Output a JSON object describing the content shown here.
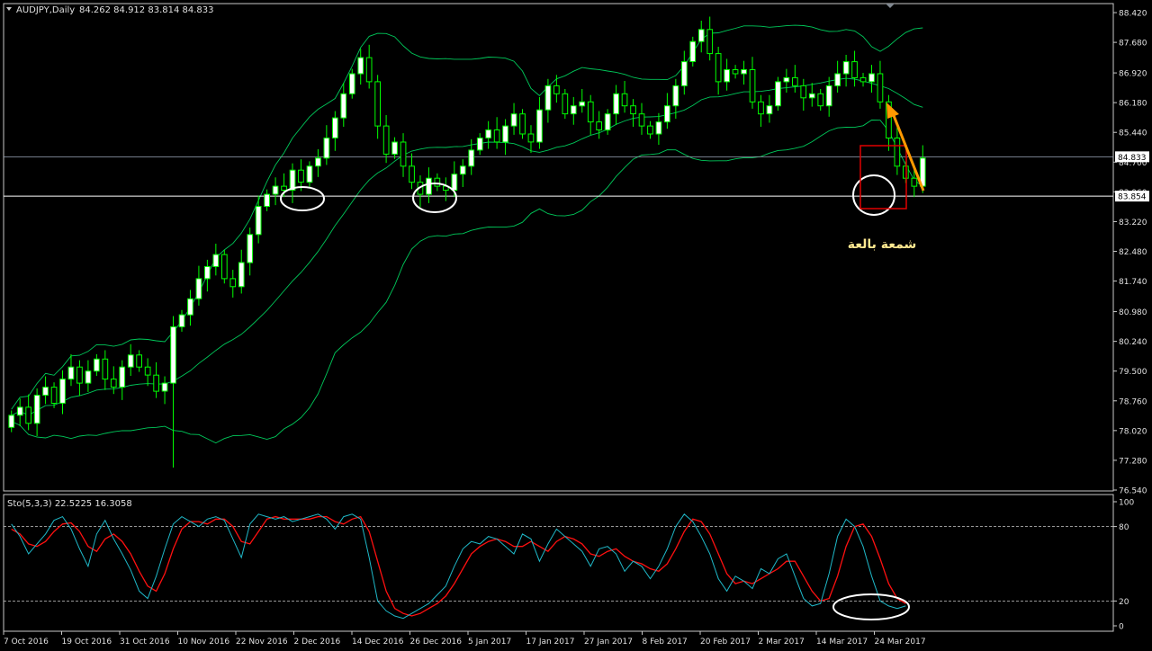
{
  "header": {
    "symbol_label": "AUDJPY,Daily",
    "ohlc_label": "84.262 84.912 83.814 84.833"
  },
  "stoch_label": "Sto(5,3,3) 22.5225 16.3058",
  "annotation_text": "شمعة بالعة",
  "colors": {
    "background": "#000000",
    "axis": "#c8c8c8",
    "bull_candle": "#ffffff",
    "bear_candle": "#000000",
    "wick": "#00ff00",
    "bollinger": "#00c85a",
    "stoch_main": "#1fb8c8",
    "stoch_signal": "#ff1010",
    "annotation_text": "#ffe890",
    "arrow": "#ff9900",
    "box": "#e00000",
    "ellipse": "#ffffff"
  },
  "chart_data": [
    {
      "type": "candlestick",
      "name": "AUDJPY,Daily",
      "y_range": [
        76.54,
        88.6
      ],
      "y_ticks": [
        "88.420",
        "87.680",
        "86.920",
        "86.180",
        "85.440",
        "84.700",
        "83.960",
        "83.220",
        "82.480",
        "81.740",
        "80.980",
        "80.240",
        "79.500",
        "78.760",
        "78.020",
        "77.280",
        "76.540"
      ],
      "x_tick_labels": [
        "7 Oct 2016",
        "19 Oct 2016",
        "31 Oct 2016",
        "10 Nov 2016",
        "22 Nov 2016",
        "2 Dec 2016",
        "14 Dec 2016",
        "26 Dec 2016",
        "5 Jan 2017",
        "17 Jan 2017",
        "27 Jan 2017",
        "8 Feb 2017",
        "20 Feb 2017",
        "2 Mar 2017",
        "14 Mar 2017",
        "24 Mar 2017"
      ],
      "current_price": "84.833",
      "horizontal_line_price": "83.854",
      "close_series": [
        78.4,
        78.6,
        78.2,
        78.9,
        79.1,
        78.7,
        79.3,
        79.6,
        79.2,
        79.5,
        79.8,
        79.3,
        79.1,
        79.6,
        79.9,
        79.6,
        79.4,
        79.0,
        79.2,
        80.6,
        80.9,
        81.3,
        81.8,
        82.1,
        82.4,
        81.8,
        81.6,
        82.2,
        82.9,
        83.6,
        83.9,
        84.1,
        84.0,
        84.5,
        84.2,
        84.6,
        84.8,
        85.3,
        85.8,
        86.4,
        86.9,
        87.3,
        86.7,
        85.6,
        84.9,
        85.2,
        84.6,
        84.2,
        83.9,
        84.3,
        84.1,
        84.0,
        84.4,
        84.6,
        85.0,
        85.3,
        85.5,
        85.2,
        85.6,
        85.9,
        85.4,
        85.2,
        86.0,
        86.6,
        86.4,
        85.9,
        86.1,
        86.2,
        85.7,
        85.5,
        85.9,
        86.4,
        86.1,
        85.9,
        85.6,
        85.4,
        85.7,
        86.1,
        86.6,
        87.2,
        87.7,
        88.0,
        87.4,
        86.7,
        87.0,
        86.9,
        87.0,
        86.2,
        85.9,
        86.1,
        86.7,
        86.8,
        86.6,
        86.3,
        86.4,
        86.1,
        86.6,
        86.9,
        87.2,
        86.8,
        86.7,
        86.9,
        86.2,
        85.3,
        84.6,
        84.3,
        84.1,
        84.8
      ]
    },
    {
      "type": "line",
      "name": "Sto(5,3,3)",
      "y_range": [
        0,
        100
      ],
      "y_ticks": [
        "100",
        "80",
        "20",
        "0"
      ],
      "levels": [
        80,
        20
      ],
      "series": [
        {
          "name": "main",
          "values": [
            82,
            72,
            58,
            66,
            74,
            85,
            88,
            78,
            62,
            48,
            74,
            85,
            70,
            58,
            45,
            28,
            22,
            40,
            62,
            82,
            88,
            84,
            80,
            86,
            88,
            85,
            70,
            55,
            82,
            90,
            88,
            86,
            88,
            84,
            86,
            88,
            90,
            86,
            78,
            88,
            90,
            86,
            55,
            20,
            12,
            8,
            6,
            10,
            14,
            18,
            25,
            32,
            48,
            62,
            68,
            66,
            72,
            70,
            64,
            58,
            74,
            70,
            52,
            66,
            78,
            72,
            66,
            60,
            48,
            62,
            64,
            58,
            44,
            52,
            48,
            38,
            48,
            62,
            80,
            90,
            84,
            72,
            58,
            38,
            28,
            40,
            36,
            30,
            46,
            42,
            54,
            58,
            40,
            22,
            16,
            18,
            42,
            72,
            86,
            80,
            64,
            40,
            20,
            16,
            14,
            16
          ]
        },
        {
          "name": "signal",
          "values": [
            78,
            74,
            66,
            64,
            68,
            76,
            82,
            83,
            76,
            64,
            60,
            70,
            74,
            68,
            58,
            44,
            32,
            28,
            42,
            62,
            78,
            84,
            84,
            82,
            86,
            86,
            80,
            68,
            66,
            76,
            86,
            88,
            86,
            86,
            86,
            86,
            88,
            88,
            84,
            82,
            86,
            88,
            76,
            52,
            28,
            14,
            10,
            8,
            10,
            14,
            18,
            24,
            34,
            46,
            58,
            64,
            68,
            70,
            68,
            64,
            64,
            68,
            64,
            60,
            68,
            72,
            70,
            66,
            58,
            56,
            60,
            62,
            56,
            52,
            50,
            46,
            44,
            50,
            62,
            76,
            86,
            84,
            74,
            58,
            42,
            34,
            36,
            34,
            38,
            42,
            46,
            52,
            52,
            40,
            28,
            20,
            22,
            40,
            64,
            80,
            82,
            72,
            54,
            34,
            22,
            18
          ]
        }
      ]
    }
  ]
}
